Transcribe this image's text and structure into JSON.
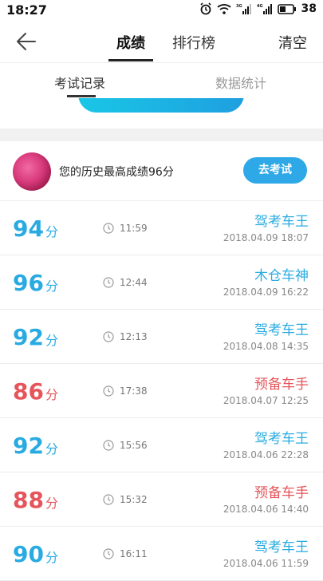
{
  "status_bar": {
    "time": "18:27",
    "battery": "38"
  },
  "header": {
    "tabs": [
      "成绩",
      "排行榜"
    ],
    "clear_label": "清空"
  },
  "subtabs": [
    "考试记录",
    "数据统计"
  ],
  "profile": {
    "best_text": "您的历史最高成绩96分",
    "exam_button": "去考试"
  },
  "records": [
    {
      "score": "94",
      "unit": "分",
      "duration": "11:59",
      "title": "驾考车王",
      "date": "2018.04.09 18:07",
      "color": "blue"
    },
    {
      "score": "96",
      "unit": "分",
      "duration": "12:44",
      "title": "木仓车神",
      "date": "2018.04.09 16:22",
      "color": "blue"
    },
    {
      "score": "92",
      "unit": "分",
      "duration": "12:13",
      "title": "驾考车王",
      "date": "2018.04.08 14:35",
      "color": "blue"
    },
    {
      "score": "86",
      "unit": "分",
      "duration": "17:38",
      "title": "预备车手",
      "date": "2018.04.07 12:25",
      "color": "red"
    },
    {
      "score": "92",
      "unit": "分",
      "duration": "15:56",
      "title": "驾考车王",
      "date": "2018.04.06 22:28",
      "color": "blue"
    },
    {
      "score": "88",
      "unit": "分",
      "duration": "15:32",
      "title": "预备车手",
      "date": "2018.04.06 14:40",
      "color": "red"
    },
    {
      "score": "90",
      "unit": "分",
      "duration": "16:11",
      "title": "驾考车王",
      "date": "2018.04.06 11:59",
      "color": "blue"
    }
  ]
}
